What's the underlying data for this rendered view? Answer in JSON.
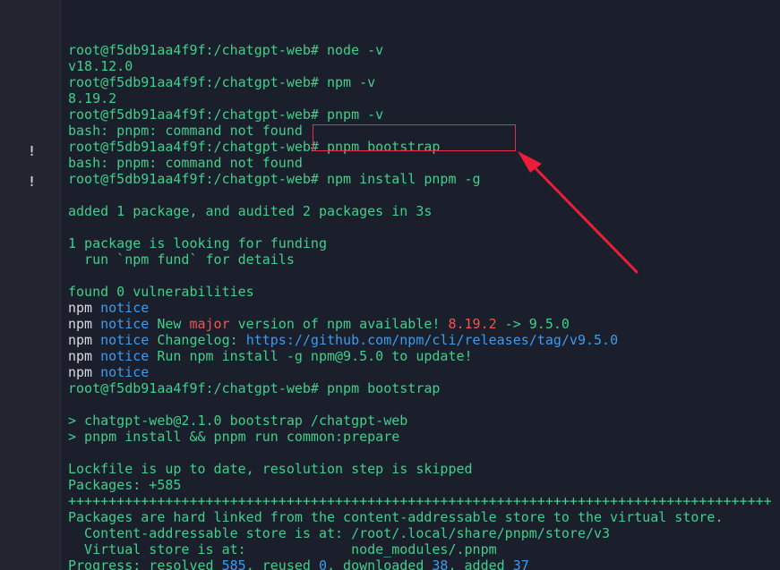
{
  "gutter": {
    "marks": [
      "!",
      "!"
    ]
  },
  "terminal": {
    "lines": [
      {
        "segments": [
          {
            "text": "root@f5db91aa4f9f:/chatgpt-web# node -v",
            "color": "green"
          }
        ]
      },
      {
        "segments": [
          {
            "text": "v18.12.0",
            "color": "green"
          }
        ]
      },
      {
        "segments": [
          {
            "text": "root@f5db91aa4f9f:/chatgpt-web# npm -v",
            "color": "green"
          }
        ]
      },
      {
        "segments": [
          {
            "text": "8.19.2",
            "color": "green"
          }
        ]
      },
      {
        "segments": [
          {
            "text": "root@f5db91aa4f9f:/chatgpt-web# pnpm -v",
            "color": "green"
          }
        ]
      },
      {
        "segments": [
          {
            "text": "bash: pnpm: command not found",
            "color": "green"
          }
        ]
      },
      {
        "segments": [
          {
            "text": "root@f5db91aa4f9f:/chatgpt-web# pnpm bootstrap",
            "color": "green"
          }
        ]
      },
      {
        "segments": [
          {
            "text": "bash: pnpm: command not found",
            "color": "green"
          }
        ]
      },
      {
        "segments": [
          {
            "text": "root@f5db91aa4f9f:/chatgpt-web# npm install pnpm -g",
            "color": "green"
          }
        ]
      },
      {
        "segments": [
          {
            "text": "",
            "color": "green"
          }
        ]
      },
      {
        "segments": [
          {
            "text": "added 1 package, and audited 2 packages in 3s",
            "color": "green"
          }
        ]
      },
      {
        "segments": [
          {
            "text": "",
            "color": "green"
          }
        ]
      },
      {
        "segments": [
          {
            "text": "1 package is looking for funding",
            "color": "green"
          }
        ]
      },
      {
        "segments": [
          {
            "text": "  run `npm fund` for details",
            "color": "green"
          }
        ]
      },
      {
        "segments": [
          {
            "text": "",
            "color": "green"
          }
        ]
      },
      {
        "segments": [
          {
            "text": "found 0 vulnerabilities",
            "color": "green"
          }
        ]
      },
      {
        "segments": [
          {
            "text": "npm ",
            "color": "white"
          },
          {
            "text": "notice",
            "color": "blue"
          }
        ]
      },
      {
        "segments": [
          {
            "text": "npm ",
            "color": "white"
          },
          {
            "text": "notice",
            "color": "blue"
          },
          {
            "text": " New ",
            "color": "green"
          },
          {
            "text": "major",
            "color": "red"
          },
          {
            "text": " version of npm available! ",
            "color": "green"
          },
          {
            "text": "8.19.2",
            "color": "red"
          },
          {
            "text": " -> ",
            "color": "green"
          },
          {
            "text": "9.5.0",
            "color": "green"
          }
        ]
      },
      {
        "segments": [
          {
            "text": "npm ",
            "color": "white"
          },
          {
            "text": "notice",
            "color": "blue"
          },
          {
            "text": " Changelog: ",
            "color": "green"
          },
          {
            "text": "https://github.com/npm/cli/releases/tag/v9.5.0",
            "color": "blue"
          }
        ]
      },
      {
        "segments": [
          {
            "text": "npm ",
            "color": "white"
          },
          {
            "text": "notice",
            "color": "blue"
          },
          {
            "text": " Run npm install -g npm@9.5.0 to update!",
            "color": "green"
          }
        ]
      },
      {
        "segments": [
          {
            "text": "npm ",
            "color": "white"
          },
          {
            "text": "notice",
            "color": "blue"
          }
        ]
      },
      {
        "segments": [
          {
            "text": "root@f5db91aa4f9f:/chatgpt-web# pnpm bootstrap",
            "color": "green"
          }
        ]
      },
      {
        "segments": [
          {
            "text": "",
            "color": "green"
          }
        ]
      },
      {
        "segments": [
          {
            "text": "> chatgpt-web@2.1.0 bootstrap /chatgpt-web",
            "color": "green"
          }
        ]
      },
      {
        "segments": [
          {
            "text": "> pnpm install && pnpm run common:prepare",
            "color": "green"
          }
        ]
      },
      {
        "segments": [
          {
            "text": "",
            "color": "green"
          }
        ]
      },
      {
        "segments": [
          {
            "text": "Lockfile is up to date, resolution step is skipped",
            "color": "green"
          }
        ]
      },
      {
        "segments": [
          {
            "text": "Packages: +585",
            "color": "green"
          }
        ]
      },
      {
        "segments": [
          {
            "text": "+++++++++++++++++++++++++++++++++++++++++++++++++++++++++++++++++++++++++++++++++++++++",
            "color": "green"
          }
        ]
      },
      {
        "segments": [
          {
            "text": "Packages are hard linked from the content-addressable store to the virtual store.",
            "color": "green"
          }
        ]
      },
      {
        "segments": [
          {
            "text": "  Content-addressable store is at: /root/.local/share/pnpm/store/v3",
            "color": "green"
          }
        ]
      },
      {
        "segments": [
          {
            "text": "  Virtual store is at:             node_modules/.pnpm",
            "color": "green"
          }
        ]
      },
      {
        "segments": [
          {
            "text": "Progress: resolved ",
            "color": "green"
          },
          {
            "text": "585",
            "color": "blue"
          },
          {
            "text": ", reused ",
            "color": "green"
          },
          {
            "text": "0",
            "color": "blue"
          },
          {
            "text": ", downloaded ",
            "color": "green"
          },
          {
            "text": "38",
            "color": "blue"
          },
          {
            "text": ", added ",
            "color": "green"
          },
          {
            "text": "37",
            "color": "blue"
          }
        ]
      }
    ]
  },
  "annotation": {
    "box_color": "#e0304a",
    "arrow_color": "#ee1c3a"
  }
}
